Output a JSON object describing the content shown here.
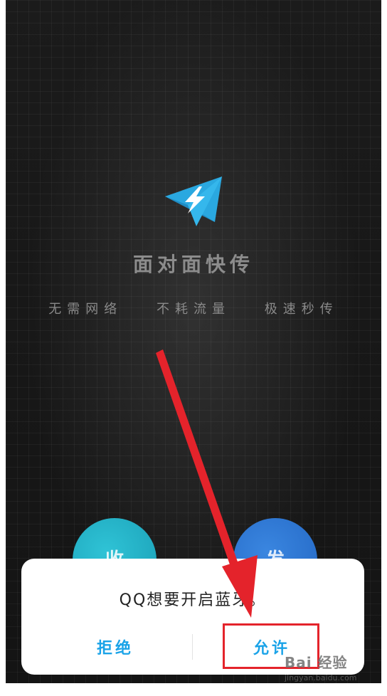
{
  "app": {
    "title": "面对面快传",
    "features": [
      "无需网络",
      "不耗流量",
      "极速秒传"
    ]
  },
  "buttons": {
    "receive_glyph": "收",
    "send_glyph": "发"
  },
  "dialog": {
    "message": "QQ想要开启蓝牙。",
    "reject_label": "拒绝",
    "allow_label": "允许"
  },
  "watermark": {
    "main": "Bai 经验",
    "sub": "jingyan.baidu.com"
  },
  "colors": {
    "accent_blue": "#1aa3e8",
    "logo_blue": "#2aa8e0",
    "annotation_red": "#e4232b",
    "receive_button": "#1fb0c6",
    "send_button": "#2a74d2"
  },
  "icons": {
    "logo": "paper-plane-lightning-icon"
  }
}
